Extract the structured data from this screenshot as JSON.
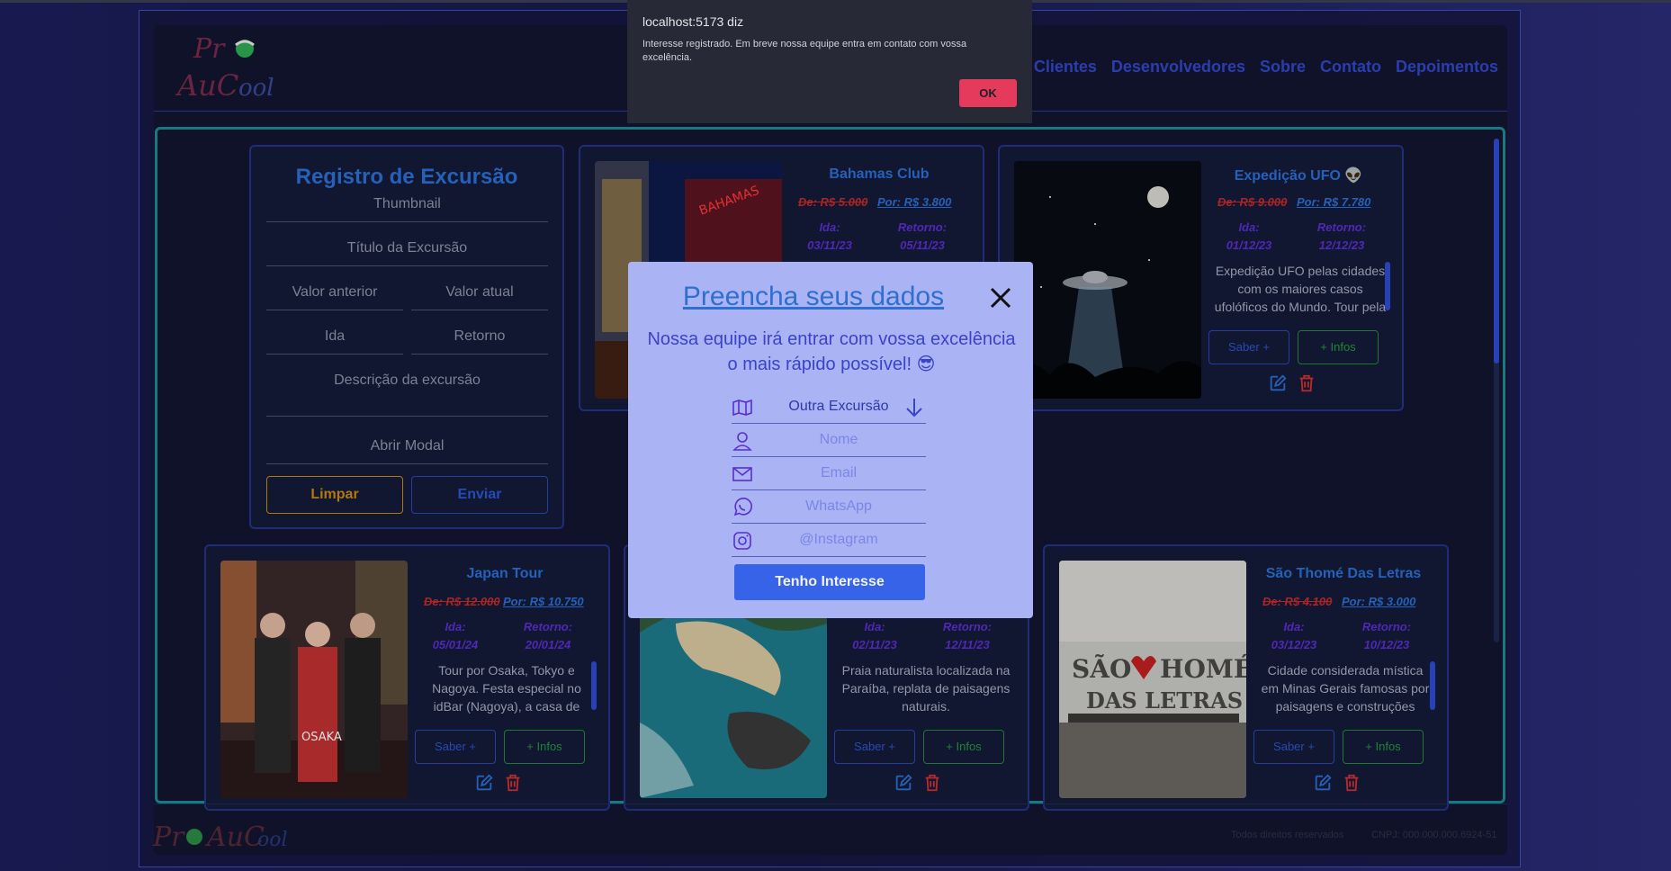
{
  "nav": {
    "items": [
      "veis Clientes",
      "Desenvolvedores",
      "Sobre",
      "Contato",
      "Depoimentos"
    ]
  },
  "form": {
    "title": "Registro de Excursão",
    "thumbnail_placeholder": "Thumbnail",
    "title_placeholder": "Título da Excursão",
    "prev_value_placeholder": "Valor anterior",
    "curr_value_placeholder": "Valor atual",
    "departure_placeholder": "Ida",
    "return_placeholder": "Retorno",
    "description_placeholder": "Descrição da excursão",
    "modal_placeholder": "Abrir Modal",
    "clear_label": "Limpar",
    "send_label": "Enviar"
  },
  "labels": {
    "departure": "Ida:",
    "return": "Retorno:",
    "saber": "Saber +",
    "infos": "+ Infos"
  },
  "cards": [
    {
      "title": "Bahamas Club",
      "old_price": "De: R$ 5.000",
      "new_price": "Por: R$ 3.800",
      "departure": "03/11/23",
      "return": "05/11/23",
      "description": ""
    },
    {
      "title": "Expedição UFO 👽",
      "old_price": "De: R$ 9.000",
      "new_price": "Por: R$ 7.780",
      "departure": "01/12/23",
      "return": "12/12/23",
      "description": "Expedição UFO pelas cidades com os maiores casos ufolóficos do Mundo. Tour pela Ilha de Colares"
    },
    {
      "title": "Japan Tour",
      "old_price": "De: R$ 12.000",
      "new_price": "Por: R$ 10.750",
      "departure": "05/01/24",
      "return": "20/01/24",
      "description": "Tour por Osaka, Tokyo e Nagoya. Festa especial no idBar (Nagoya), a casa de show mais frequentada por"
    },
    {
      "title": "",
      "old_price": "",
      "new_price": "",
      "departure": "02/11/23",
      "return": "12/11/23",
      "description": "Praia naturalista localizada na Paraíba, replata de paisagens naturais."
    },
    {
      "title": "São Thomé Das Letras",
      "old_price": "De: R$ 4.100",
      "new_price": "Por: R$ 3.000",
      "departure": "03/12/23",
      "return": "10/12/23",
      "description": "Cidade considerada mística em Minas Gerais famosas por paisagens e construções rochosas, avistamentos"
    }
  ],
  "footer": {
    "rights": "Todos direitos reservados",
    "cnpj": "CNPJ: 000.000.000.6924-51"
  },
  "modal": {
    "title": "Preencha seus dados",
    "subtitle": "Nossa equipe irá entrar com vossa excelência o mais rápido possível! 😎",
    "excursion_value": "Outra Excursão",
    "name_placeholder": "Nome",
    "email_placeholder": "Email",
    "whatsapp_placeholder": "WhatsApp",
    "instagram_placeholder": "@Instagram",
    "submit_label": "Tenho Interesse"
  },
  "alert": {
    "title": "localhost:5173 diz",
    "message": "Interesse registrado. Em breve nossa equipe entra em contato com vossa excelência.",
    "ok_label": "OK"
  },
  "colors": {
    "accent": "#2b6fd3",
    "modal_bg": "#aab3f4",
    "submit_bg": "#3763e8",
    "alert_ok": "#e53a5c"
  }
}
